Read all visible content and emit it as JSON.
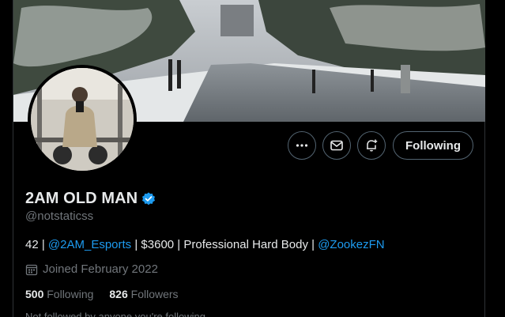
{
  "profile": {
    "display_name": "2AM OLD MAN",
    "handle": "@notstaticss",
    "bio": {
      "part1": "42 | ",
      "link1": "@2AM_Esports",
      "part2": " | $3600 | Professional Hard Body | ",
      "link2": "@ZookezFN"
    },
    "joined": "Joined February 2022",
    "following_count": "500",
    "following_label": "Following",
    "followers_count": "826",
    "followers_label": "Followers",
    "followed_by_note": "Not followed by anyone you're following"
  },
  "actions": {
    "follow_button_label": "Following",
    "more_icon": "more-horizontal-icon",
    "message_icon": "envelope-icon",
    "notify_icon": "bell-plus-icon"
  },
  "colors": {
    "accent": "#1d9bf0",
    "muted": "#71767b",
    "border": "#536471",
    "background": "#000000"
  }
}
